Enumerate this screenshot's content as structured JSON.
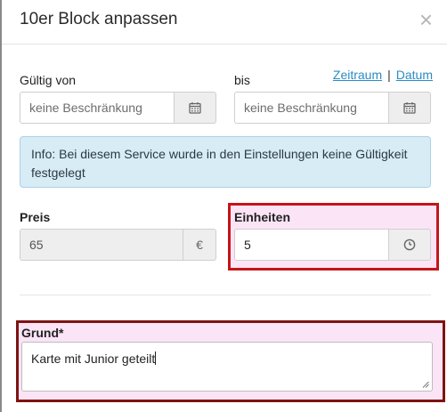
{
  "dialog": {
    "title": "10er Block anpassen",
    "close_symbol": "×"
  },
  "validity": {
    "from_label": "Gültig von",
    "to_label": "bis",
    "from_placeholder": "keine Beschränkung",
    "to_placeholder": "keine Beschränkung",
    "link_zeitraum": "Zeitraum",
    "link_separator": "|",
    "link_datum": "Datum"
  },
  "info": {
    "text": "Info: Bei diesem Service wurde in den Einstellungen keine Gültigkeit festgelegt"
  },
  "price": {
    "label": "Preis",
    "value": "65",
    "currency": "€"
  },
  "units": {
    "label": "Einheiten",
    "value": "5"
  },
  "reason": {
    "label": "Grund*",
    "value": "Karte mit Junior geteilt"
  },
  "colors": {
    "accent_link": "#2a8bc4",
    "info_bg": "#d8ecf6",
    "highlight_red": "#c4151a",
    "highlight_brown": "#7d1412"
  },
  "icons": [
    "close-icon",
    "calendar-icon",
    "euro-icon",
    "clock-icon",
    "resize-handle-icon"
  ]
}
